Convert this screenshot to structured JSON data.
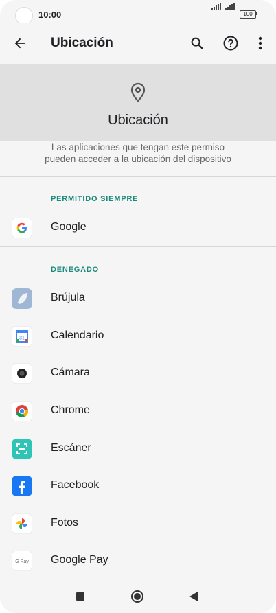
{
  "status_bar": {
    "time": "10:00",
    "battery": "100"
  },
  "app_bar": {
    "title": "Ubicación",
    "back_icon": "arrow-left-icon",
    "search_icon": "search-icon",
    "help_icon": "help-circle-icon",
    "menu_icon": "more-vert-icon"
  },
  "header": {
    "icon": "location-pin-icon",
    "title": "Ubicación"
  },
  "description": {
    "line1": "Las aplicaciones que tengan este permiso",
    "line2": "pueden acceder a la ubicación del dispositivo"
  },
  "sections": {
    "allowed": {
      "title": "PERMITIDO SIEMPRE",
      "apps": [
        {
          "name": "Google"
        }
      ]
    },
    "denied": {
      "title": "DENEGADO",
      "apps": [
        {
          "name": "Brújula"
        },
        {
          "name": "Calendario"
        },
        {
          "name": "Cámara"
        },
        {
          "name": "Chrome"
        },
        {
          "name": "Escáner"
        },
        {
          "name": "Facebook"
        },
        {
          "name": "Fotos"
        },
        {
          "name": "Google Pay"
        }
      ]
    }
  },
  "nav_bar": {
    "recents_icon": "square-icon",
    "home_icon": "circle-icon",
    "back_icon": "triangle-back-icon"
  },
  "colors": {
    "accent": "#1a8a7a",
    "header_bg": "#e0e0e0",
    "bg": "#f5f5f5"
  }
}
